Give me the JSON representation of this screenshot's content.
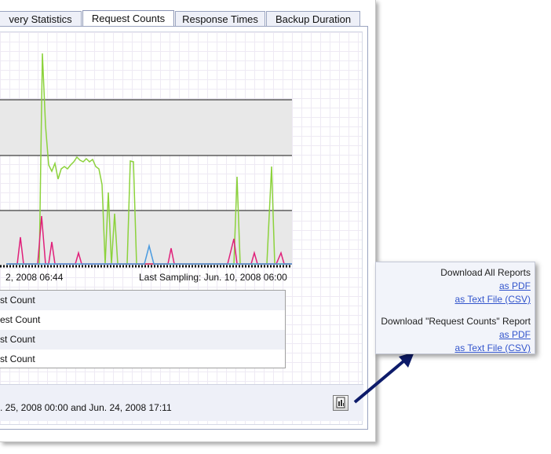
{
  "tabs": [
    {
      "label": "very Statistics",
      "active": false
    },
    {
      "label": "Request Counts",
      "active": true
    },
    {
      "label": "Response Times",
      "active": false
    },
    {
      "label": "Backup Duration",
      "active": false
    }
  ],
  "chart": {
    "start_label": "2, 2008 06:44",
    "end_label": "Last Sampling: Jun. 10, 2008 06:00",
    "colors": {
      "green": "#8cd23c",
      "pink": "#e0207a",
      "blue": "#4a9be0",
      "band": "#e8e8e8"
    }
  },
  "legend": {
    "rows": [
      "st Count",
      "est Count",
      "st Count",
      "st Count"
    ]
  },
  "footer": {
    "text": ". 25, 2008 00:00 and Jun. 24, 2008 17:11",
    "export_icon": "report-export-icon"
  },
  "popup": {
    "all_reports_heading": "Download All Reports",
    "all_pdf": "as PDF",
    "all_csv": "as Text File (CSV)",
    "single_heading": "Download \"Request Counts\" Report",
    "single_pdf": "as PDF",
    "single_csv": "as Text File (CSV)"
  }
}
